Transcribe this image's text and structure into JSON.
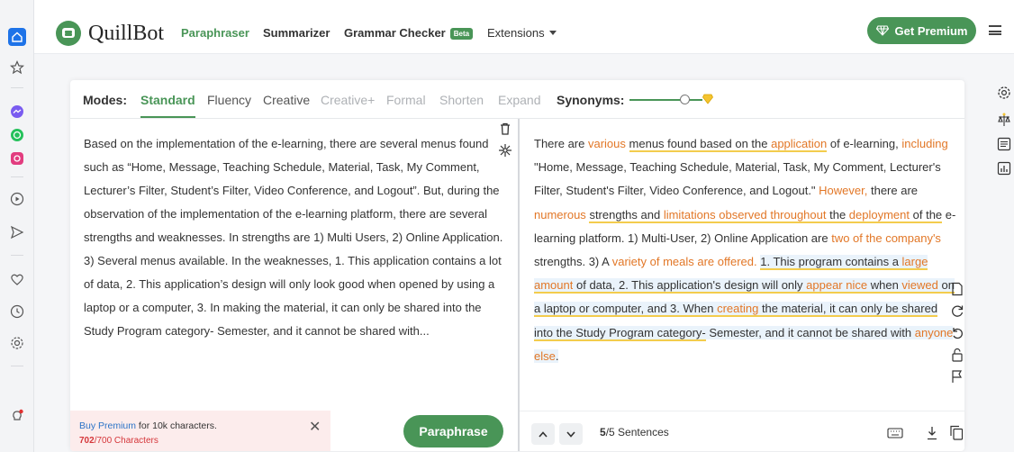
{
  "header": {
    "logo_text": "QuillBot",
    "nav": {
      "paraphraser": "Paraphraser",
      "summarizer": "Summarizer",
      "grammar_checker": "Grammar Checker",
      "beta_badge": "Beta",
      "extensions": "Extensions"
    },
    "premium_button": "Get Premium"
  },
  "modes": {
    "label": "Modes:",
    "items": [
      "Standard",
      "Fluency",
      "Creative",
      "Creative+",
      "Formal",
      "Shorten",
      "Expand"
    ],
    "active": "Standard",
    "synonyms_label": "Synonyms:",
    "synonyms_level": 0.8
  },
  "input": {
    "text": "Based on the implementation of the e-learning, there are several menus found such as “Home, Message, Teaching Schedule, Material, Task, My Comment, Lecturer’s Filter, Student’s Filter, Video Conference, and Logout”. But, during the observation of the implementation of the e-learning platform, there are several strengths and weaknesses. In strengths are 1) Multi Users, 2) Online Application. 3) Several menus available. In the weaknesses, 1. This application contains a lot of data, 2. This application’s design will only look good when opened by using a laptop or a computer, 3. In making the material, it can only be shared into the Study Program category- Semester, and it cannot be shared with..."
  },
  "output": {
    "segments": [
      {
        "t": "There are ",
        "s": ""
      },
      {
        "t": "various",
        "s": "ch"
      },
      {
        "t": " ",
        "s": ""
      },
      {
        "t": "menus found based on the ",
        "s": "st"
      },
      {
        "t": "application",
        "s": "ch st"
      },
      {
        "t": " of e-learning, ",
        "s": ""
      },
      {
        "t": "including",
        "s": "ch"
      },
      {
        "t": " \"Home, Message, Teaching Schedule, Material, Task, My Comment, Lecturer's Filter, Student's Filter, Video Conference, and Logout.\" ",
        "s": ""
      },
      {
        "t": "However,",
        "s": "ch"
      },
      {
        "t": " there are ",
        "s": ""
      },
      {
        "t": "numerous",
        "s": "ch"
      },
      {
        "t": " ",
        "s": ""
      },
      {
        "t": "strengths and ",
        "s": "st"
      },
      {
        "t": "limitations observed throughout",
        "s": "ch st"
      },
      {
        "t": " the ",
        "s": "st"
      },
      {
        "t": "deployment",
        "s": "ch st"
      },
      {
        "t": " of the",
        "s": "st"
      },
      {
        "t": " e-learning platform. 1) Multi-User, 2) Online Application are ",
        "s": ""
      },
      {
        "t": "two of the company's",
        "s": "ch"
      },
      {
        "t": " strengths. 3) A ",
        "s": ""
      },
      {
        "t": "variety of meals are offered.",
        "s": "ch"
      },
      {
        "t": " ",
        "s": ""
      },
      {
        "t": "1. This program contains a ",
        "s": "ph"
      },
      {
        "t": "large amount",
        "s": "ch ph"
      },
      {
        "t": " of data, 2. This application's design will only ",
        "s": "ph"
      },
      {
        "t": "appear nice",
        "s": "ch ph"
      },
      {
        "t": " when ",
        "s": "ph"
      },
      {
        "t": "viewed",
        "s": "ch ph"
      },
      {
        "t": " on a laptop or computer, and 3. When ",
        "s": "ph"
      },
      {
        "t": "creating",
        "s": "ch ph"
      },
      {
        "t": " the material, it can only be shared into the Study Program category-",
        "s": "ph"
      },
      {
        "t": " Semester, and it cannot be shared with ",
        "s": "lg"
      },
      {
        "t": "anyone else",
        "s": "ch lg"
      },
      {
        "t": ".",
        "s": "lg"
      }
    ]
  },
  "footer": {
    "buy_premium": "Buy Premium",
    "buy_rest": " for 10k characters.",
    "char_count": "702",
    "char_limit": "/700 Characters",
    "paraphrase_button": "Paraphrase",
    "sentence_count": "5",
    "sentence_total": "/5 Sentences"
  },
  "colors": {
    "accent": "#499557",
    "changed": "#e27727",
    "structure": "#f3cc4d",
    "longest": "#eaf3fb"
  }
}
